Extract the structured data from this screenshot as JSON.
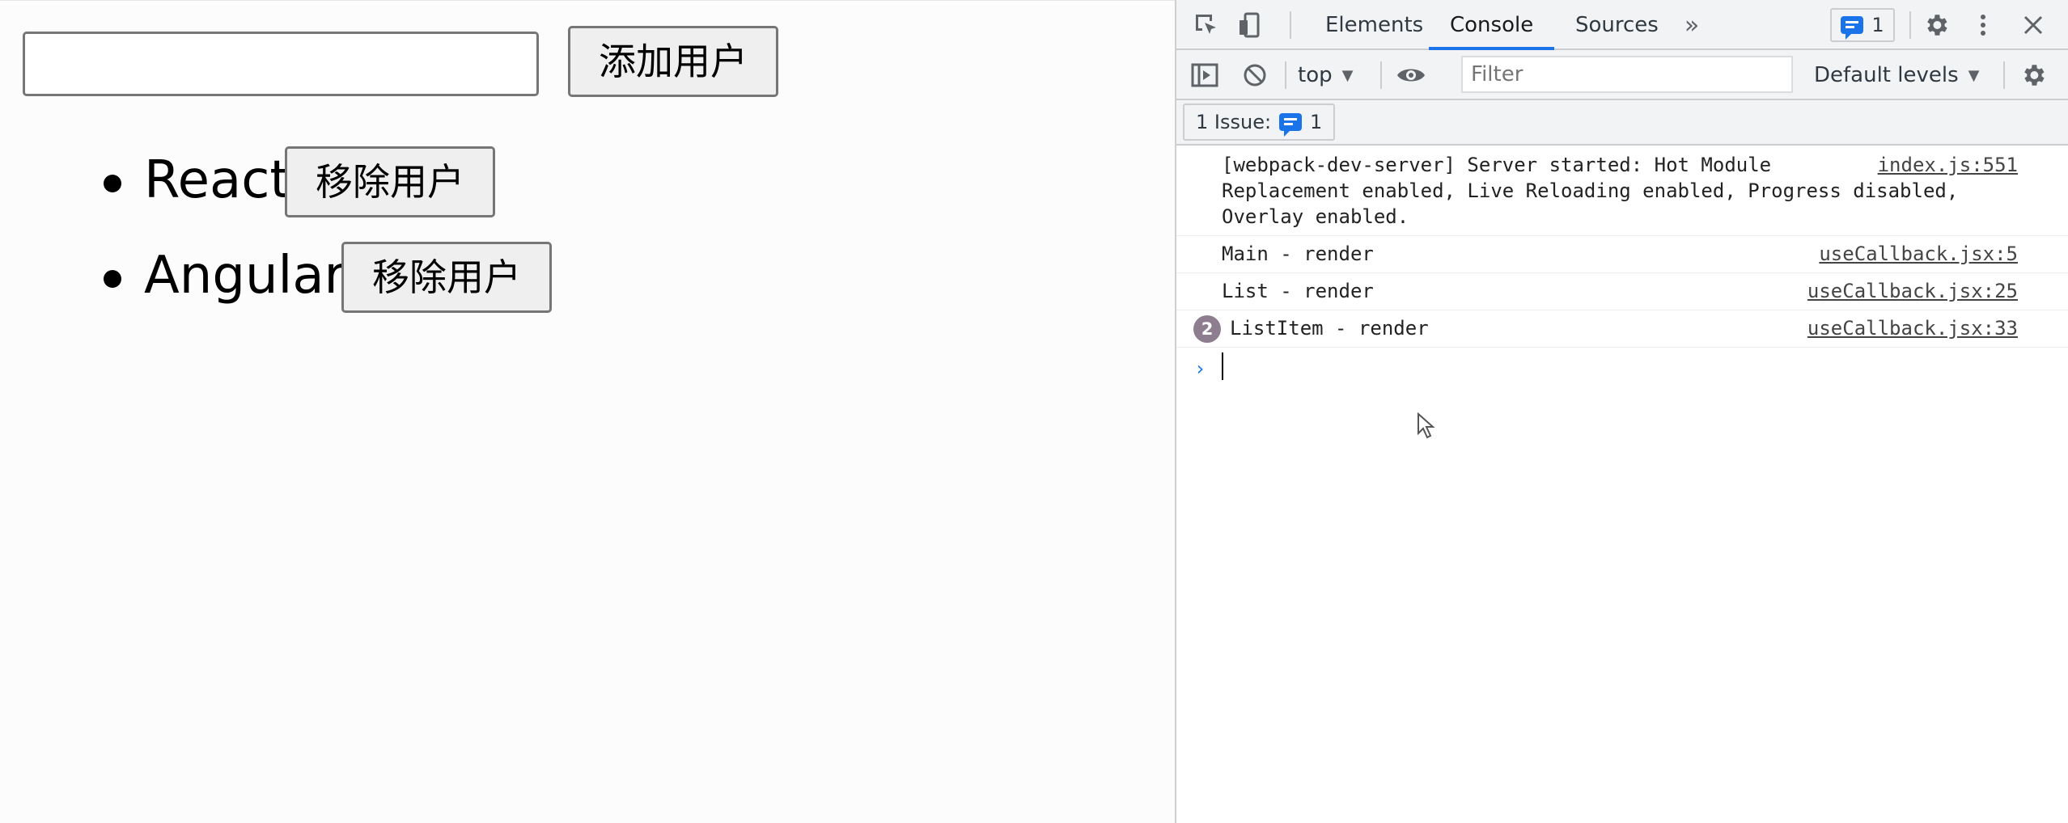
{
  "page": {
    "input": {
      "value": "",
      "placeholder": ""
    },
    "add_button_label": "添加用户",
    "users": [
      {
        "name": "React",
        "remove_label": "移除用户"
      },
      {
        "name": "Angular",
        "remove_label": "移除用户"
      }
    ]
  },
  "devtools": {
    "tabs": [
      {
        "label": "Elements",
        "active": false
      },
      {
        "label": "Console",
        "active": true
      },
      {
        "label": "Sources",
        "active": false
      }
    ],
    "more_tabs_icon": "chevron-double-right-icon",
    "issues_badge_count": "1",
    "toolbar": {
      "context": "top",
      "filter_placeholder": "Filter",
      "levels": "Default levels"
    },
    "issues_bar": {
      "label": "1 Issue:",
      "count": "1"
    },
    "console": {
      "logs": [
        {
          "text_lines": [
            "[webpack-dev-server] Server started: Hot Module",
            "Replacement enabled, Live Reloading enabled, Progress disabled,",
            "Overlay enabled."
          ],
          "source": "index.js:551"
        },
        {
          "text": "Main - render",
          "source": "useCallback.jsx:5"
        },
        {
          "text": "List - render",
          "source": "useCallback.jsx:25"
        },
        {
          "text": "ListItem - render",
          "source": "useCallback.jsx:33",
          "repeat_count": "2"
        }
      ]
    },
    "colors": {
      "accent": "#1a73e8",
      "toolbar_bg": "#f1f3f4",
      "badge": "#8d7d8f"
    }
  }
}
